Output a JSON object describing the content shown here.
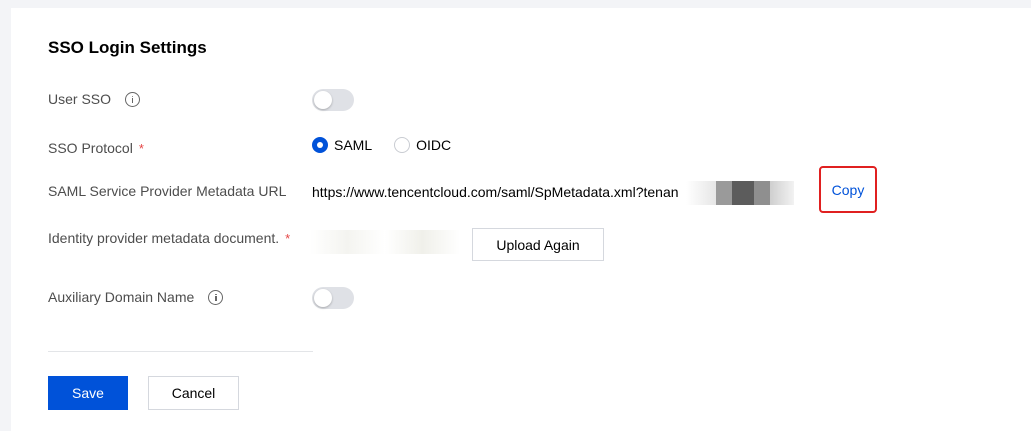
{
  "page": {
    "title": "SSO Login Settings"
  },
  "user_sso": {
    "label": "User SSO",
    "enabled": false
  },
  "sso_protocol": {
    "label": "SSO Protocol",
    "required_mark": "*",
    "options": [
      {
        "label": "SAML",
        "selected": true
      },
      {
        "label": "OIDC",
        "selected": false
      }
    ]
  },
  "metadata_url": {
    "label": "SAML Service Provider Metadata URL",
    "value": "https://www.tencentcloud.com/saml/SpMetadata.xml?tenan",
    "copy_label": "Copy"
  },
  "idp_metadata": {
    "label": "Identity provider metadata document.",
    "required_mark": "*",
    "upload_label": "Upload Again"
  },
  "aux_domain": {
    "label": "Auxiliary Domain Name",
    "enabled": false
  },
  "actions": {
    "save_label": "Save",
    "cancel_label": "Cancel"
  },
  "colors": {
    "primary": "#0052d9",
    "required": "#e54545",
    "highlight_border": "#e02020"
  }
}
